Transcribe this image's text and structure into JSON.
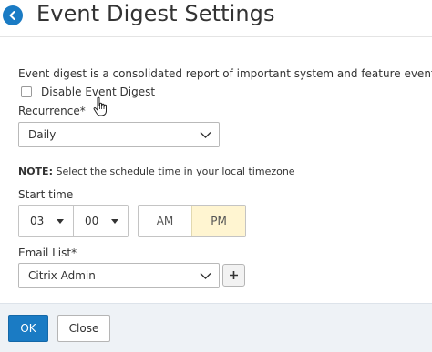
{
  "header": {
    "title": "Event Digest Settings",
    "back_icon": "arrow-left-icon"
  },
  "form": {
    "description": "Event digest is a consolidated report of important system and feature events",
    "disable_checkbox": {
      "label": "Disable Event Digest",
      "checked": false
    },
    "recurrence": {
      "label": "Recurrence*",
      "value": "Daily"
    },
    "note": {
      "bold": "NOTE:",
      "text": " Select the schedule time in your local timezone"
    },
    "start_time": {
      "label": "Start time",
      "hour": "03",
      "minute": "00",
      "am_label": "AM",
      "pm_label": "PM",
      "selected_period": "PM"
    },
    "email_list": {
      "label": "Email List*",
      "value": "Citrix Admin",
      "add_icon": "plus-icon"
    }
  },
  "footer": {
    "ok_label": "OK",
    "close_label": "Close"
  },
  "colors": {
    "primary": "#1a7bc4",
    "selected_toggle": "#fff5d1",
    "footer_bg": "#eef2f6"
  }
}
